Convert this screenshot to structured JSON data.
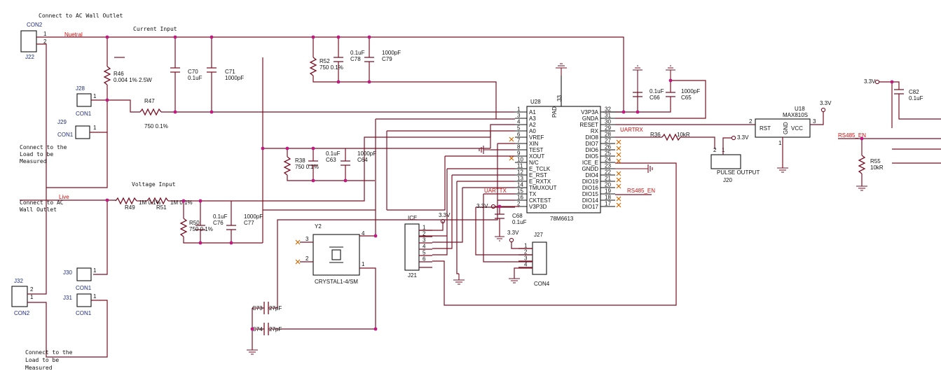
{
  "notes": {
    "ac_top": "Connect to AC Wall Outlet",
    "load_1": [
      "Connect to the",
      "Load to be",
      "Measured"
    ],
    "ac_bottom": [
      "Connect to AC",
      "Wall Outlet"
    ],
    "load_2": [
      "Connect to the",
      "Load to be",
      "Measured"
    ]
  },
  "nets": {
    "neutral": "Nuetral",
    "live": "Live",
    "current_input": "Current Input",
    "voltage_input": "Voltage Input",
    "uartrx": "UARTRX",
    "uarttx": "UARTTX",
    "rs485_en_1": "RS485_EN",
    "rs485_en_2": "RS485_EN",
    "pad": "PAD",
    "pin33": "33"
  },
  "power": {
    "v33_c68": "3.3V",
    "v33_ice": "3.3V",
    "v33_j27": "3.3V",
    "v33_j20": "3.3V",
    "v33_u18": "3.3V",
    "v33_c82": "3.3V"
  },
  "connectors": {
    "con2_top": {
      "ref": "CON2",
      "des": "J22",
      "p1": "1",
      "p2": "2"
    },
    "j28": {
      "ref": "J28",
      "type": "CON1",
      "pin": "1"
    },
    "j29": {
      "ref": "J29",
      "type": "CON1",
      "pin": "1"
    },
    "j30": {
      "ref": "J30",
      "type": "CON1",
      "pin": "1"
    },
    "j31": {
      "ref": "J31",
      "type": "CON1",
      "pin": "1"
    },
    "j32": {
      "ref": "J32",
      "type": "CON2",
      "p1": "1",
      "p2": "2"
    },
    "j21": {
      "ref": "J21",
      "title": "ICE",
      "pins": [
        "1",
        "2",
        "3",
        "4",
        "5",
        "6"
      ]
    },
    "j27": {
      "ref": "J27",
      "type": "CON4",
      "pins": [
        "1",
        "2",
        "3",
        "4"
      ]
    },
    "j20": {
      "ref": "J20",
      "title": "PULSE OUTPUT",
      "p1": "1",
      "p2": "2"
    }
  },
  "parts": {
    "r46": {
      "ref": "R46",
      "val": "0.004 1% 2.5W"
    },
    "r47": {
      "ref": "R47",
      "val": "750 0.1%"
    },
    "c70": {
      "ref": "C70",
      "val": "0.1uF"
    },
    "c71": {
      "ref": "C71",
      "val": "1000pF"
    },
    "r52": {
      "ref": "R52",
      "val": "750 0.1%"
    },
    "c78": {
      "ref": "C78",
      "val": "0.1uF"
    },
    "c79": {
      "ref": "C79",
      "val": "1000pF"
    },
    "r38": {
      "ref": "R38",
      "val": "750 0.1%"
    },
    "c63": {
      "ref": "C63",
      "val": "0.1uF"
    },
    "c64": {
      "ref": "C64",
      "val": "1000pF"
    },
    "r49": {
      "ref": "R49",
      "val": "1M 0.1%"
    },
    "r51": {
      "ref": "R51",
      "val": "1M 0.1%"
    },
    "r50": {
      "ref": "R50",
      "val": "750 0.1%"
    },
    "c76": {
      "ref": "C76",
      "val": "0.1uF"
    },
    "c77": {
      "ref": "C77",
      "val": "1000pF"
    },
    "y2": {
      "ref": "Y2",
      "val": "CRYSTAL1-4/SM",
      "p1": "1",
      "p2": "2",
      "p3": "3",
      "p4": "4"
    },
    "c73": {
      "ref": "C73",
      "val": "27pF"
    },
    "c74": {
      "ref": "C74",
      "val": "27pF"
    },
    "c68": {
      "ref": "C68",
      "val": "0.1uF"
    },
    "c66": {
      "ref": "C66",
      "val": "0.1uF"
    },
    "c65": {
      "ref": "C65",
      "val": "1000pF"
    },
    "r36": {
      "ref": "R36",
      "val": "10kR"
    },
    "r55": {
      "ref": "R55",
      "val": "10kR"
    },
    "c82": {
      "ref": "C82",
      "val": "0.1uF"
    }
  },
  "u28": {
    "ref": "U28",
    "part": "78M6613",
    "left_pins": [
      {
        "num": "1",
        "name": "A1"
      },
      {
        "num": "3",
        "name": "A3"
      },
      {
        "num": "4",
        "name": "A2"
      },
      {
        "num": "5",
        "name": "A0"
      },
      {
        "num": "6",
        "name": "VREF"
      },
      {
        "num": "7",
        "name": "XIN"
      },
      {
        "num": "8",
        "name": "TEST"
      },
      {
        "num": "9",
        "name": "XOUT"
      },
      {
        "num": "10",
        "name": "N/C"
      },
      {
        "num": "11",
        "name": "E_TCLK"
      },
      {
        "num": "12",
        "name": "E_RST"
      },
      {
        "num": "13",
        "name": "E_RXTX"
      },
      {
        "num": "14",
        "name": "TMUXOUT"
      },
      {
        "num": "15",
        "name": "TX"
      },
      {
        "num": "16",
        "name": "CKTEST"
      },
      {
        "num": "2",
        "name": "V3P3D"
      }
    ],
    "right_pins": [
      {
        "num": "32",
        "name": "V3P3A"
      },
      {
        "num": "31",
        "name": "GNDA"
      },
      {
        "num": "30",
        "name": "RESET"
      },
      {
        "num": "29",
        "name": "RX"
      },
      {
        "num": "28",
        "name": "DIO8"
      },
      {
        "num": "27",
        "name": "DIO7"
      },
      {
        "num": "26",
        "name": "DIO6"
      },
      {
        "num": "25",
        "name": "DIO5"
      },
      {
        "num": "24",
        "name": "ICE_E"
      },
      {
        "num": "23",
        "name": "GNDD"
      },
      {
        "num": "22",
        "name": "DIO4"
      },
      {
        "num": "21",
        "name": "DIO19"
      },
      {
        "num": "20",
        "name": "DIO16"
      },
      {
        "num": "19",
        "name": "DIO15"
      },
      {
        "num": "18",
        "name": "DIO14"
      },
      {
        "num": "17",
        "name": "DIO17"
      }
    ]
  },
  "u18": {
    "ref": "U18",
    "part": "MAX810S",
    "rst": "RST",
    "gnd": "GND",
    "vcc": "VCC",
    "p1": "1",
    "p2": "2",
    "p3": "3"
  }
}
